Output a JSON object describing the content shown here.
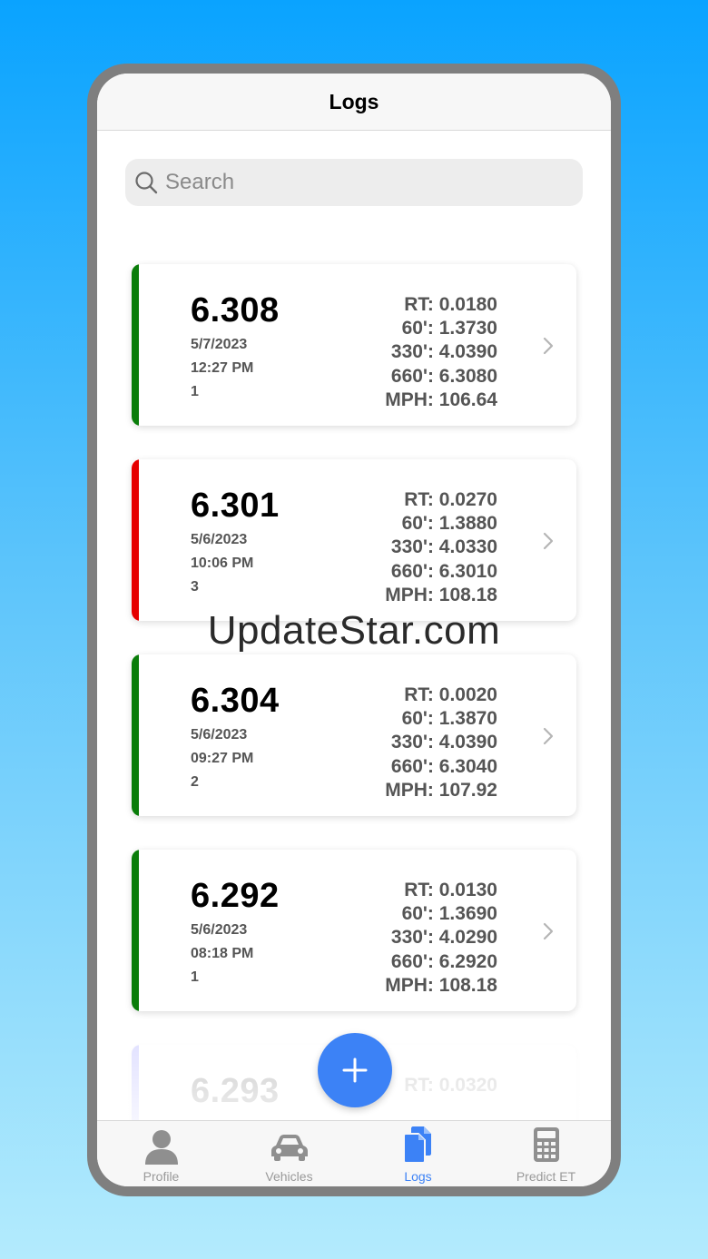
{
  "header": {
    "title": "Logs"
  },
  "search": {
    "placeholder": "Search",
    "value": ""
  },
  "logs": [
    {
      "et": "6.308",
      "date": "5/7/2023",
      "time": "12:27 PM",
      "lane": "1",
      "rt": "RT: 0.0180",
      "ft60": "60': 1.3730",
      "ft330": "330': 4.0390",
      "ft660": "660': 6.3080",
      "mph": "MPH: 106.64",
      "bar_color": "#0a7d0a"
    },
    {
      "et": "6.301",
      "date": "5/6/2023",
      "time": "10:06 PM",
      "lane": "3",
      "rt": "RT: 0.0270",
      "ft60": "60': 1.3880",
      "ft330": "330': 4.0330",
      "ft660": "660': 6.3010",
      "mph": "MPH: 108.18",
      "bar_color": "#e60000"
    },
    {
      "et": "6.304",
      "date": "5/6/2023",
      "time": "09:27 PM",
      "lane": "2",
      "rt": "RT: 0.0020",
      "ft60": "60': 1.3870",
      "ft330": "330': 4.0390",
      "ft660": "660': 6.3040",
      "mph": "MPH: 107.92",
      "bar_color": "#0a7d0a"
    },
    {
      "et": "6.292",
      "date": "5/6/2023",
      "time": "08:18 PM",
      "lane": "1",
      "rt": "RT: 0.0130",
      "ft60": "60': 1.3690",
      "ft330": "330': 4.0290",
      "ft660": "660': 6.2920",
      "mph": "MPH: 108.18",
      "bar_color": "#0a7d0a"
    },
    {
      "et": "6.293",
      "rt": "RT: 0.0320",
      "bar_color": "#6b6bff"
    }
  ],
  "fab": {
    "icon": "plus-icon"
  },
  "tabs": [
    {
      "label": "Profile",
      "icon": "person-icon"
    },
    {
      "label": "Vehicles",
      "icon": "car-icon"
    },
    {
      "label": "Logs",
      "icon": "documents-icon",
      "active": true
    },
    {
      "label": "Predict ET",
      "icon": "calculator-icon"
    }
  ],
  "watermark": "UpdateStar.com",
  "colors": {
    "accent": "#3c82f6",
    "green": "#0a7d0a",
    "red": "#e60000"
  }
}
